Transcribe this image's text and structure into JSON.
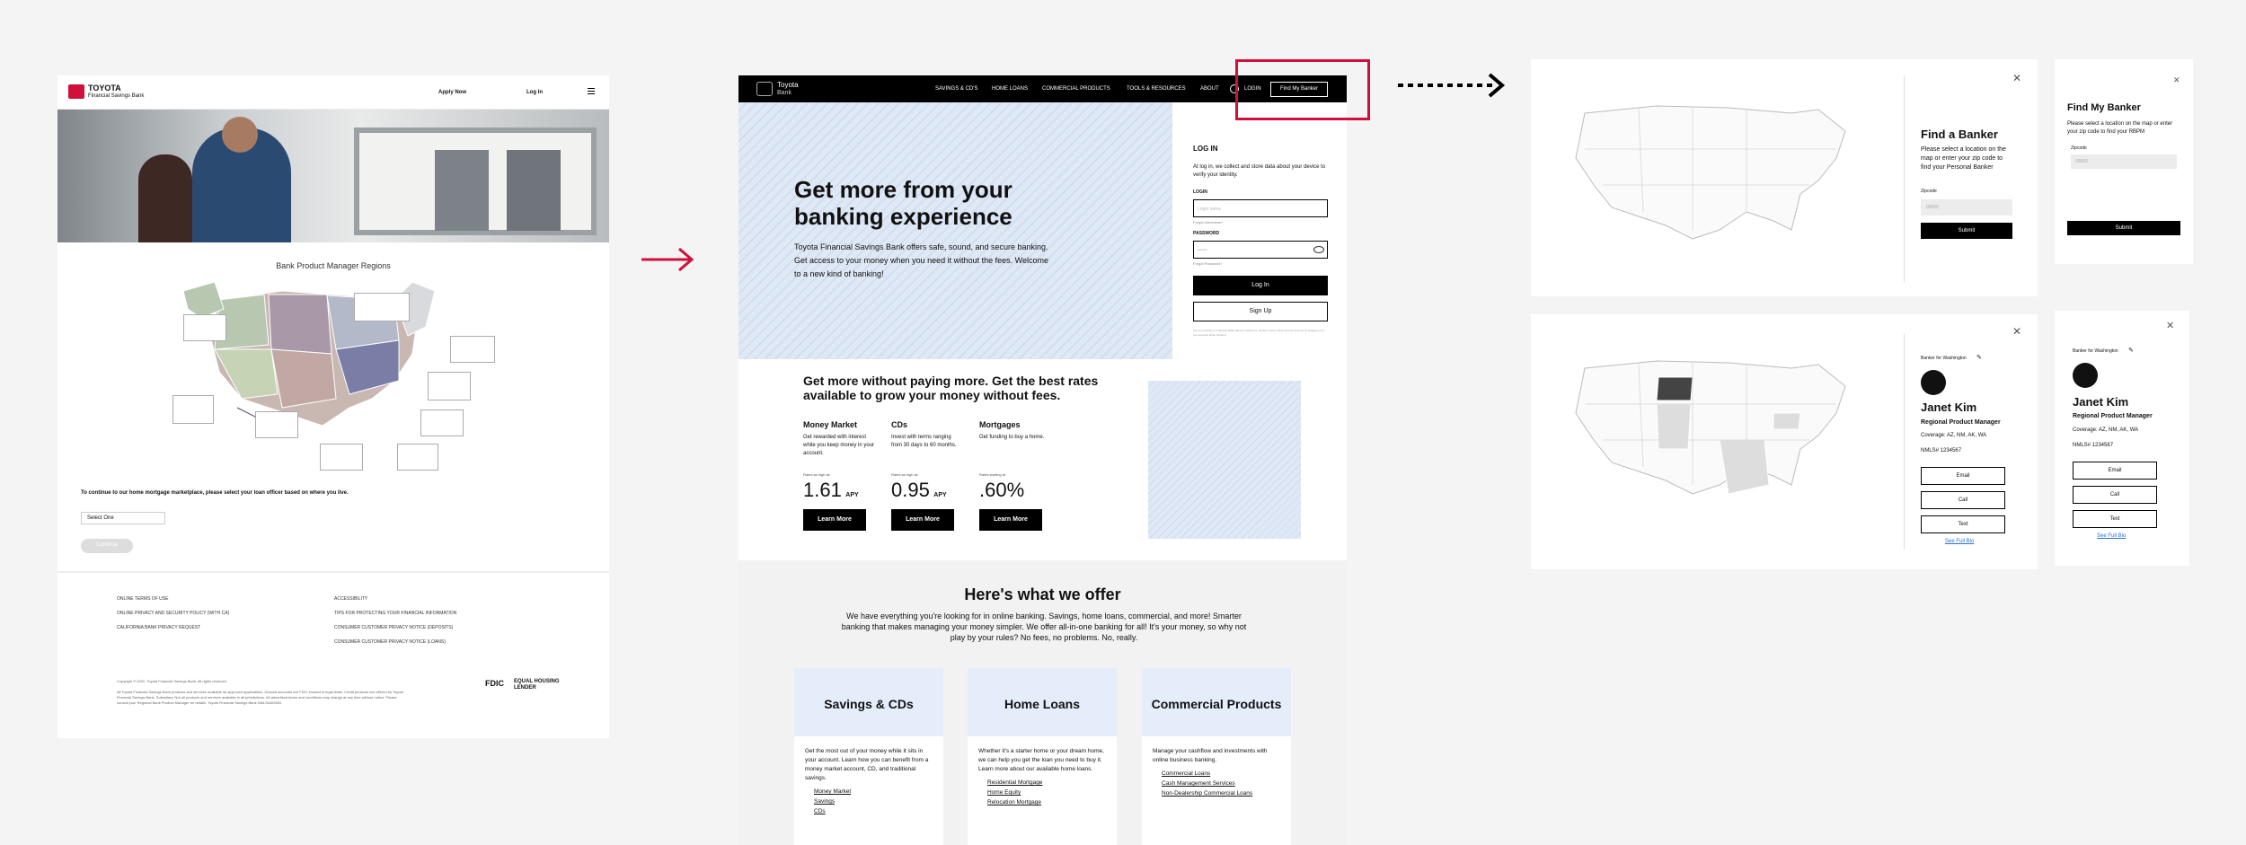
{
  "panel1": {
    "brand": "TOYOTA",
    "brand_sub": "Financial Savings Bank",
    "nav": [
      "Apply Now",
      "Log In"
    ],
    "map_title": "Bank Product Manager Regions",
    "instruction": "To continue to our home mortgage marketplace, please select your loan officer based on where you live.",
    "select_value": "Select One",
    "continue_label": "Continue",
    "footer_links_left": [
      "ONLINE TERMS OF USE",
      "ONLINE PRIVACY AND SECURITY POLICY (WITH CA)",
      "CALIFORNIA BANK PRIVACY REQUEST"
    ],
    "footer_links_right": [
      "ACCESSIBILITY",
      "TIPS FOR PROTECTING YOUR FINANCIAL INFORMATION",
      "CONSUMER CUSTOMER PRIVACY NOTICE (DEPOSITS)",
      "CONSUMER CUSTOMER PRIVACY NOTICE (LOANS)"
    ],
    "copyright": "Copyright © 2022. Toyota Financial Savings Bank. All rights reserved.",
    "disclaimer": "All Toyota Financial Savings Bank products and services available as approved applications. Deposit accounts are FDIC insured to legal limits. Credit products are offered by Toyota Financial Savings Bank. Subsidiary. Not all products and services available in all jurisdictions. All advertised terms and conditions may change at any time without notice. Please consult your Regional Bank Product Manager for details. Toyota Financial Savings Bank NMLS#469281",
    "fdic": "FDIC",
    "lender": "EQUAL HOUSING LENDER"
  },
  "panel2": {
    "brand": "Toyota",
    "brand_sub": "Bank",
    "nav": [
      "SAVINGS & CD'S",
      "HOME LOANS",
      "COMMERCIAL PRODUCTS",
      "TOOLS & RESOURCES",
      "ABOUT"
    ],
    "login_nav": "LOGIN",
    "find_banker": "Find My Banker",
    "hero_title": "Get more from your banking experience",
    "hero_text": "Toyota Financial Savings Bank offers safe, sound, and secure banking. Get access to your money when you need it without the fees. Welcome to a new kind of banking!",
    "login": {
      "title": "LOG IN",
      "desc": "At log in, we collect and store data about your device to verify your identity.",
      "login_label": "LOGIN",
      "login_placeholder": "Login name",
      "forgot_login": "Forgot Username?",
      "password_label": "PASSWORD",
      "password_placeholder": "••••••",
      "forgot_password": "Forgot Password?",
      "login_button": "Log In",
      "signup_button": "Sign Up",
      "fine_print": "For the protection of Savings Bank deposit customers, please ensure online account security by logging out of your account when finished."
    },
    "rates_title": "Get more without paying more. Get the best rates available to grow your money without fees.",
    "rates": [
      {
        "title": "Money Market",
        "desc": "Get rewarded with interest while you keep money in your account.",
        "small": "Rates as high as",
        "rate": "1.61",
        "unit": "APY",
        "button": "Learn More"
      },
      {
        "title": "CDs",
        "desc": "Invest with terms ranging from 30 days to 60 months.",
        "small": "Rates as high as",
        "rate": "0.95",
        "unit": "APY",
        "button": "Learn More"
      },
      {
        "title": "Mortgages",
        "desc": "Get funding to buy a home.",
        "small": "Rates starting at",
        "rate": ".60%",
        "unit": "",
        "button": "Learn More"
      }
    ],
    "offer_title": "Here's what we offer",
    "offer_text": "We have everything you're looking for in online banking. Savings, home loans, commercial, and more! Smarter banking that makes managing your money simpler. We offer all-in-one banking for all! It's your money, so why not play by your rules? No fees, no problems. No, really.",
    "cards": [
      {
        "title": "Savings & CDs",
        "desc": "Get the most out of your money while it sits in your account. Learn how you can benefit from a money market account, CD, and traditional savings.",
        "links": [
          "Money Market",
          "Savings",
          "CDs"
        ]
      },
      {
        "title": "Home Loans",
        "desc": "Whether it's a starter home or your dream home, we can help you get the loan you need to buy it. Learn more about our available home loans.",
        "links": [
          "Residential Mortgage",
          "Home Equity",
          "Relocation Mortgage"
        ]
      },
      {
        "title": "Commercial Products",
        "desc": "Manage your cashflow and investments with online business banking.",
        "links": [
          "Commercial Loans",
          "Cash Management Services",
          "Non-Dealership Commercial Loans"
        ]
      }
    ]
  },
  "panel3": {
    "title": "Find a Banker",
    "desc": "Please select a location on the map or enter your zip code to find your Personal Banker",
    "zip_label": "Zipcode",
    "zip_placeholder": "00000",
    "submit": "Submit"
  },
  "panel4": {
    "title": "Find My Banker",
    "desc": "Please select a location on the map or enter your zip code to find your RBPM",
    "zip_label": "Zipcode",
    "zip_placeholder": "00000",
    "submit": "Submit"
  },
  "panel5": {
    "banker_for": "Banker for Washington",
    "name": "Janet Kim",
    "role": "Regional Product Manager",
    "coverage": "Coverage: AZ, NM, AK, WA",
    "nmls": "NMLS# 1234567",
    "email": "Email",
    "call": "Call",
    "text": "Text",
    "bio": "See Full Bio"
  },
  "panel6": {
    "banker_for": "Banker for Washington",
    "name": "Janet Kim",
    "role": "Regional Product Manager",
    "coverage": "Coverage: AZ, NM, AK, WA",
    "nmls": "NMLS# 1234567",
    "email": "Email",
    "call": "Call",
    "text": "Text",
    "bio": "See Full Bio"
  },
  "colors": {
    "accent": "#d0103a",
    "black": "#000000",
    "hero_bg": "#dfe8f5"
  }
}
